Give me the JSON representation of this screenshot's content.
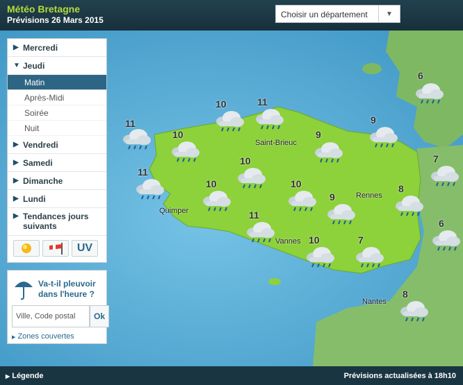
{
  "header": {
    "title": "Météo Bretagne",
    "subtitle": "Prévisions 26 Mars 2015",
    "department_select": "Choisir un département"
  },
  "sidebar": {
    "days": [
      {
        "label": "Mercredi"
      },
      {
        "label": "Jeudi",
        "expanded": true,
        "periods": [
          "Matin",
          "Après-Midi",
          "Soirée",
          "Nuit"
        ],
        "selected": "Matin"
      },
      {
        "label": "Vendredi"
      },
      {
        "label": "Samedi"
      },
      {
        "label": "Dimanche"
      },
      {
        "label": "Lundi"
      },
      {
        "label": "Tendances jours suivants"
      }
    ],
    "uv_label": "UV",
    "icons": [
      "sun-icon",
      "windsock-icon",
      "uv-icon"
    ]
  },
  "rain_widget": {
    "question": "Va-t-il pleuvoir dans l'heure ?",
    "placeholder": "Ville, Code postal",
    "ok_label": "Ok",
    "zones_link": "Zones couvertes"
  },
  "map": {
    "cities": [
      "Saint-Brieuc",
      "Quimper",
      "Rennes",
      "Vannes",
      "Nantes"
    ],
    "temperatures": [
      "11",
      "10",
      "11",
      "10",
      "9",
      "9",
      "6",
      "11",
      "10",
      "10",
      "7",
      "10",
      "9",
      "8",
      "11",
      "10",
      "7",
      "6",
      "8"
    ]
  },
  "footer": {
    "legend": "Légende",
    "updated": "Prévisions actualisées à 18h10"
  },
  "colors": {
    "land_bretagne": "#8dd13b",
    "sea": "#4ea6cf",
    "header_bg": "#1a3542",
    "title_green": "#b6dc3a",
    "selected_period": "#2e6584"
  }
}
